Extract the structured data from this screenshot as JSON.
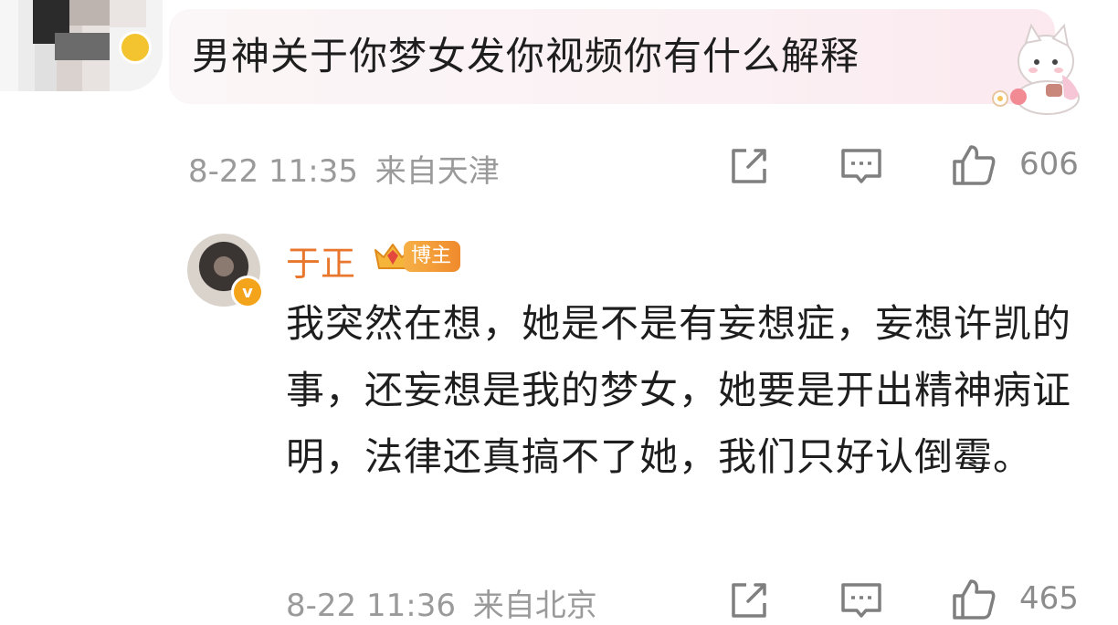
{
  "top_comment": {
    "text": "男神关于你梦女发你视频你有什么解释",
    "date_time": "8-22 11:35",
    "location": "来自天津",
    "likes": "606"
  },
  "reply": {
    "username": "于正",
    "badge_label": "博主",
    "text": "我突然在想，她是不是有妄想症，妄想许凯的事，还妄想是我的梦女，她要是开出精神病证明，法律还真搞不了她，我们只好认倒霉。",
    "date_time": "8-22 11:36",
    "location": "来自北京",
    "likes": "465"
  },
  "icons": {
    "share": "share-icon",
    "comment": "comment-icon",
    "like": "thumbs-up-icon"
  },
  "colors": {
    "username": "#e8762c",
    "meta": "#9a9a9a",
    "text": "#1e1e1e",
    "bubble": "#fbf1f4"
  }
}
